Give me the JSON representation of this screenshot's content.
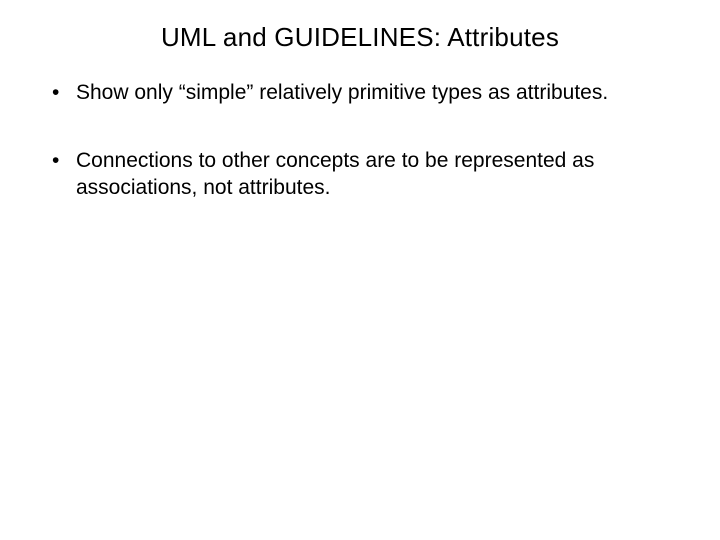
{
  "slide": {
    "title": "UML and GUIDELINES: Attributes",
    "bullets": [
      "Show only “simple” relatively primitive types as attributes.",
      "Connections to other concepts are to be represented as associations, not attributes."
    ]
  }
}
